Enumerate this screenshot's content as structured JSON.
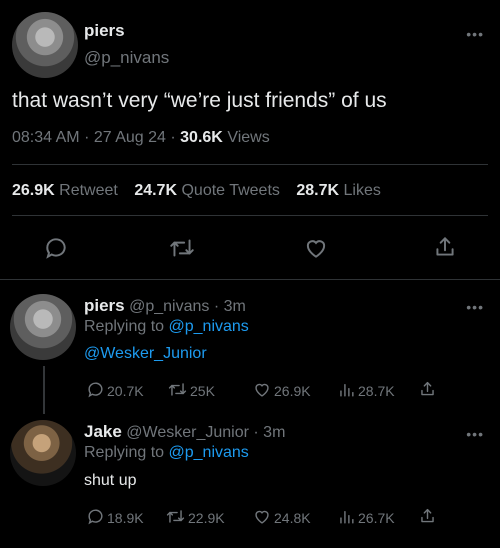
{
  "main_tweet": {
    "author_name": "piers",
    "author_handle": "@p_nivans",
    "more_icon": "more-icon",
    "text": "that wasn’t very “we’re just friends” of us",
    "time": "08:34 AM",
    "sep1": "·",
    "date": "27 Aug 24",
    "sep2": "·",
    "views_count": "30.6K",
    "views_label": "Views",
    "retweets_count": "26.9K",
    "retweets_label": "Retweet",
    "quotes_count": "24.7K",
    "quotes_label": "Quote Tweets",
    "likes_count": "28.7K",
    "likes_label": "Likes",
    "actions": [
      "reply-icon",
      "retweet-icon",
      "like-icon",
      "share-icon"
    ]
  },
  "replies": [
    {
      "author_name": "piers",
      "author_handle": "@p_nivans",
      "sep": "·",
      "age": "3m",
      "replying_label": "Replying to",
      "replying_handle": "@p_nivans",
      "text": "@Wesker_Junior",
      "reply_count": "20.7K",
      "retweet_count": "25K",
      "like_count": "26.9K",
      "view_count": "28.7K"
    },
    {
      "author_name": "Jake",
      "author_handle": "@Wesker_Junior",
      "sep": "·",
      "age": "3m",
      "replying_label": "Replying to",
      "replying_handle": "@p_nivans",
      "text": "shut up",
      "reply_count": "18.9K",
      "retweet_count": "22.9K",
      "like_count": "24.8K",
      "view_count": "26.7K"
    }
  ],
  "colors": {
    "background": "#000000",
    "text": "#e7e9ea",
    "muted": "#71767b",
    "link": "#1d9bf0",
    "divider": "#2f3336"
  }
}
